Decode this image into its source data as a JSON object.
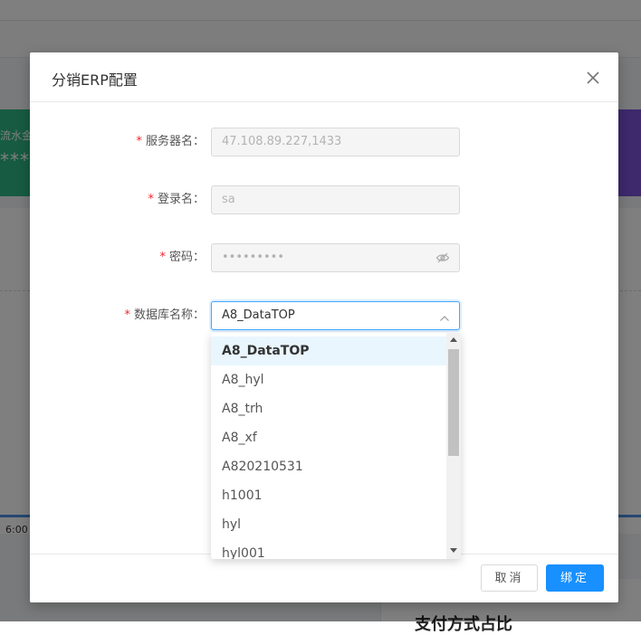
{
  "background": {
    "card_label": "流水金",
    "card_value": "****",
    "time_label": "6:00",
    "bottom_title": "支付方式占比"
  },
  "dialog": {
    "title": "分销ERP配置",
    "fields": {
      "server": {
        "label": "服务器名：",
        "value": "47.108.89.227,1433"
      },
      "login": {
        "label": "登录名：",
        "value": "sa"
      },
      "password": {
        "label": "密码：",
        "value": "•••••••••"
      },
      "database": {
        "label": "数据库名称：",
        "value": "A8_DataTOP"
      }
    },
    "required_mark": "*",
    "cancel_label": "取消",
    "bind_label": "绑定"
  },
  "dropdown": {
    "options": [
      "A8_DataTOP",
      "A8_hyl",
      "A8_trh",
      "A8_xf",
      "A820210531",
      "h1001",
      "hyl",
      "hyl001"
    ],
    "selected_index": 0
  },
  "colors": {
    "primary": "#1890ff",
    "required": "#f5222d",
    "selected_option_bg": "#e9f6fe"
  }
}
